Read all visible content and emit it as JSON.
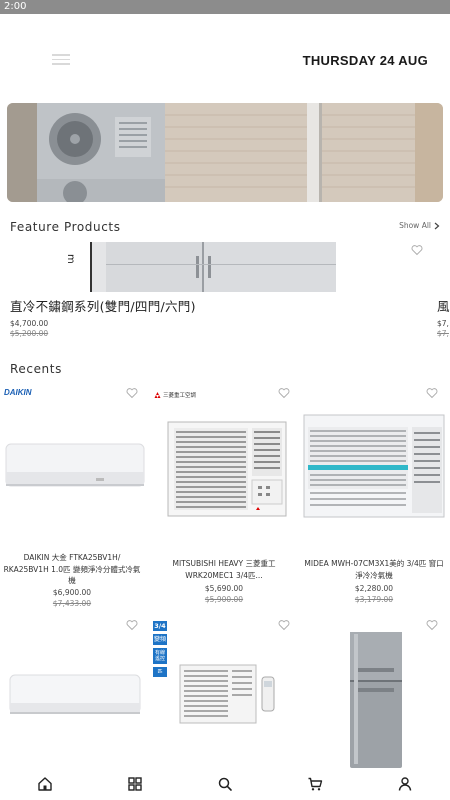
{
  "status_bar": {
    "time": "2:00"
  },
  "header": {
    "date": "THURSDAY 24 AUG"
  },
  "featured": {
    "title": "Feature Products",
    "show_all": "Show All",
    "items": [
      {
        "name": "直冷不鏽鋼系列(雙門/四門/六門)",
        "price": "$4,700.00",
        "old_price": "$5,200.00"
      },
      {
        "name": "風",
        "price": "$7,",
        "old_price": "$7,"
      }
    ]
  },
  "recents": {
    "title": "Recents",
    "items": [
      {
        "brand": "DAIKIN",
        "name": "DAIKIN 大金 FTKA25BV1H/ RKA25BV1H 1.0匹 變頻淨冷分體式冷氣機",
        "price": "$6,900.00",
        "old_price": "$7,433.00"
      },
      {
        "brand": "三菱重工空調",
        "name": "MITSUBISHI HEAVY 三菱重工 WRK20MEC1 3/4匹...",
        "price": "$5,690.00",
        "old_price": "$5,900.00"
      },
      {
        "name": "MIDEA MWH-07CM3X1美的 3/4匹 窗口淨冷冷氣機",
        "price": "$2,280.00",
        "old_price": "$3,179.00"
      }
    ],
    "partial_badges": [
      "3/4",
      "變頻",
      "有線遙控",
      "匹"
    ]
  },
  "bottom_nav": [
    "home-icon",
    "grid-icon",
    "search-icon",
    "cart-icon",
    "profile-icon"
  ],
  "colors": {
    "accent_blue": "#1a5fb4",
    "text": "#222222",
    "status_bar": "#8c8c8c"
  }
}
